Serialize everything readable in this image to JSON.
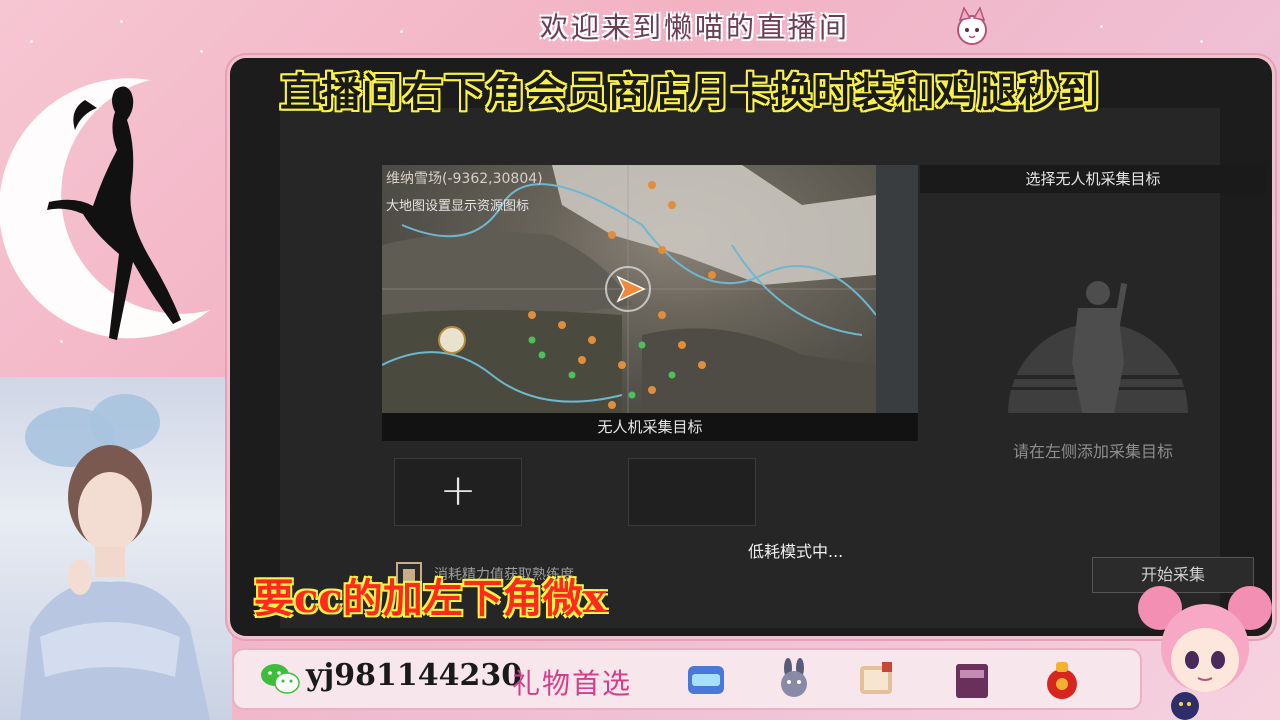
{
  "stream": {
    "welcome_banner": "欢迎来到懒喵的直播间",
    "overlay_top": "直播间右下角会员商店月卡换时装和鸡腿秒到",
    "overlay_bottom": "要cc的加左下角微x",
    "wechat_id": "yj981144230",
    "gift_title": "礼物首选",
    "gift_icons": [
      "badge-gift-icon",
      "rabbit-gift-icon",
      "scroll-gift-icon",
      "book-gift-icon",
      "lucky-bag-gift-icon"
    ]
  },
  "game": {
    "map_title": "维纳雪场(-9362,30804)",
    "map_hint": "大地图设置显示资源图标",
    "map_caption": "无人机采集目标",
    "right_panel_title": "选择无人机采集目标",
    "right_panel_hint": "请在左侧添加采集目标",
    "low_power": "低耗模式中...",
    "checkbox_label": "消耗精力值获取熟练度",
    "start_button": "开始采集",
    "slot_plus": "+"
  },
  "colors": {
    "overlay_top_stroke": "#f8f24a",
    "overlay_bottom_fill": "#ff2a1e",
    "gift_title": "#d63e8a",
    "background_pink": "#f2b2c4"
  }
}
